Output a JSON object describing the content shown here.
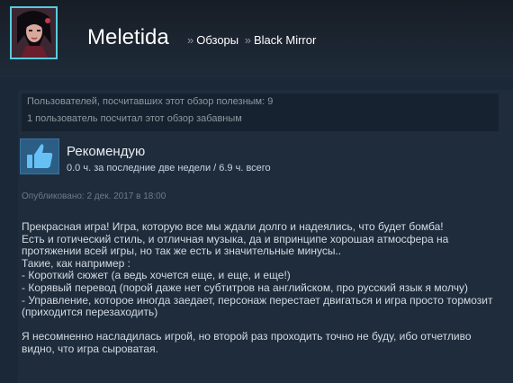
{
  "header": {
    "username": "Meletida",
    "breadcrumb_sep_1": "»",
    "breadcrumb_reviews": "Обзоры",
    "breadcrumb_sep_2": "»",
    "breadcrumb_game": "Black Mirror"
  },
  "stats": {
    "helpful": "Пользователей, посчитавших этот обзор полезным: 9",
    "funny": "1 пользователь посчитал этот обзор забавным"
  },
  "recommendation": {
    "title": "Рекомендую",
    "hours": "0.0 ч. за последние две недели / 6.9 ч. всего",
    "icon": "thumbs-up-icon"
  },
  "posted": "Опубликовано: 2 дек. 2017 в 18:00",
  "review_lines": [
    "Прекрасная игра! Игра, которую все мы ждали долго и надеялись, что будет бомба!",
    "Есть и готический стиль, и отличная музыка, да и впринципе хорошая атмосфера на",
    "протяжении всей игры, но так же есть и значительные минусы..",
    "Такие, как например :",
    "- Короткий сюжет (а ведь хочется еще, и еще, и еще!)",
    "- Корявый перевод (порой даже нет субтитров на английском, про русский язык я молчу)",
    "- Управление, которое иногда заедает, персонаж перестает двигаться и игра просто тормозит",
    "(приходится перезаходить)",
    "",
    "Я несомненно насладилась игрой, но второй раз проходить точно не буду, ибо отчетливо",
    "видно, что игра сыроватая."
  ],
  "colors": {
    "background": "#1b2838",
    "accent": "#57cbde",
    "thumb_box": "#2b5d85"
  }
}
